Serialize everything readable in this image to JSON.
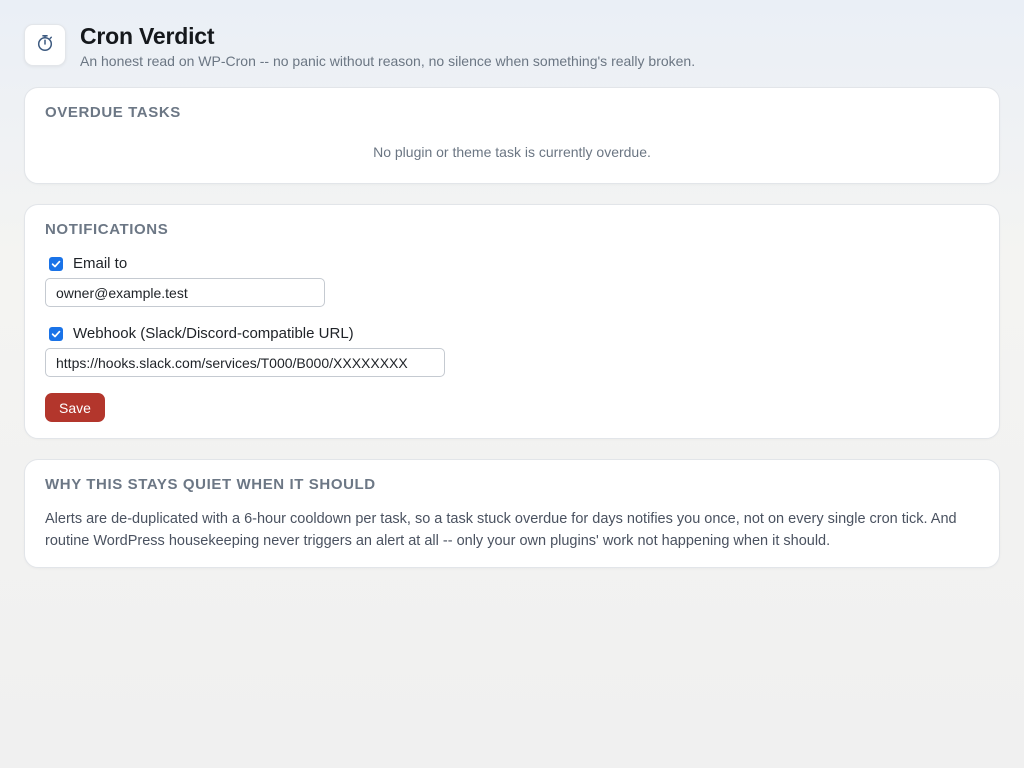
{
  "header": {
    "icon": "stopwatch-icon",
    "title": "Cron Verdict",
    "subtitle": "An honest read on WP-Cron -- no panic without reason, no silence when something's really broken."
  },
  "overdue": {
    "title": "OVERDUE TASKS",
    "empty_message": "No plugin or theme task is currently overdue."
  },
  "notifications": {
    "title": "NOTIFICATIONS",
    "email_enabled": true,
    "email_label": "Email to",
    "email_value": "owner@example.test",
    "webhook_enabled": true,
    "webhook_label": "Webhook (Slack/Discord-compatible URL)",
    "webhook_value": "https://hooks.slack.com/services/T000/B000/XXXXXXXX",
    "save_label": "Save"
  },
  "why": {
    "title": "WHY THIS STAYS QUIET WHEN IT SHOULD",
    "body": "Alerts are de-duplicated with a 6-hour cooldown per task, so a task stuck overdue for days notifies you once, not on every single cron tick. And routine WordPress housekeeping never triggers an alert at all -- only your own plugins' work not happening when it should."
  },
  "colors": {
    "accent": "#b3362c",
    "checkbox": "#1a73e8"
  }
}
